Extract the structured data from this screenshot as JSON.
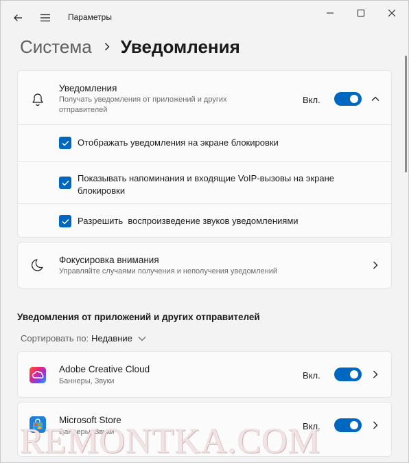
{
  "window": {
    "title": "Параметры"
  },
  "breadcrumb": {
    "parent": "Система",
    "current": "Уведомления"
  },
  "notifications": {
    "title": "Уведомления",
    "subtitle": "Получать уведомления от приложений и других отправителей",
    "toggle_label": "Вкл.",
    "toggle_on": true,
    "options": [
      {
        "label": "Отображать уведомления на экране блокировки",
        "checked": true
      },
      {
        "label": "Показывать напоминания и входящие VoIP-вызовы на экране блокировки",
        "checked": true
      },
      {
        "label": "Разрешить  воспроизведение звуков уведомлениями",
        "checked": true
      }
    ]
  },
  "focus": {
    "title": "Фокусировка внимания",
    "subtitle": "Управляйте случаями получения и неполучения уведомлений"
  },
  "apps_section": {
    "heading": "Уведомления от приложений и других отправителей",
    "sort_label": "Сортировать по:",
    "sort_value": "Недавние",
    "apps": [
      {
        "name": "Adobe Creative Cloud",
        "details": "Баннеры, Звуки",
        "toggle_label": "Вкл.",
        "toggle_on": true
      },
      {
        "name": "Microsoft Store",
        "details": "Баннеры, Звуки",
        "toggle_label": "Вкл.",
        "toggle_on": true
      }
    ]
  },
  "watermark": "REMONTKA.COM",
  "colors": {
    "accent": "#0067c0",
    "background": "#f3f3f3",
    "card": "#fbfbfb"
  }
}
